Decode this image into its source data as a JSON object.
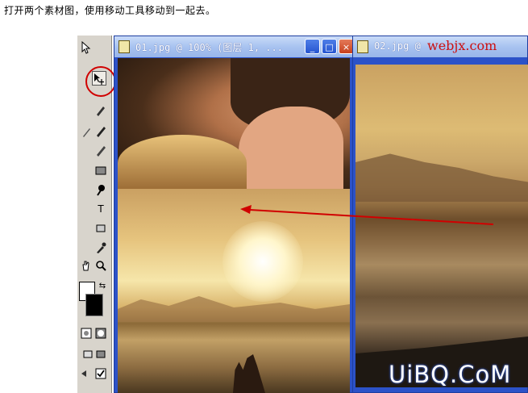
{
  "caption": "打开两个素材图，使用移动工具移动到一起去。",
  "window1": {
    "title": "01.jpg @ 100% (图层 1, ..."
  },
  "window2": {
    "title": "02.jpg @"
  },
  "watermark_top": "webjx.com",
  "watermark_bottom": "UiBQ.CoM",
  "colors": {
    "titlebar_blue": "#2c52c8",
    "annotation_red": "#d00000"
  },
  "toolbox": {
    "type_tool_label": "T"
  }
}
